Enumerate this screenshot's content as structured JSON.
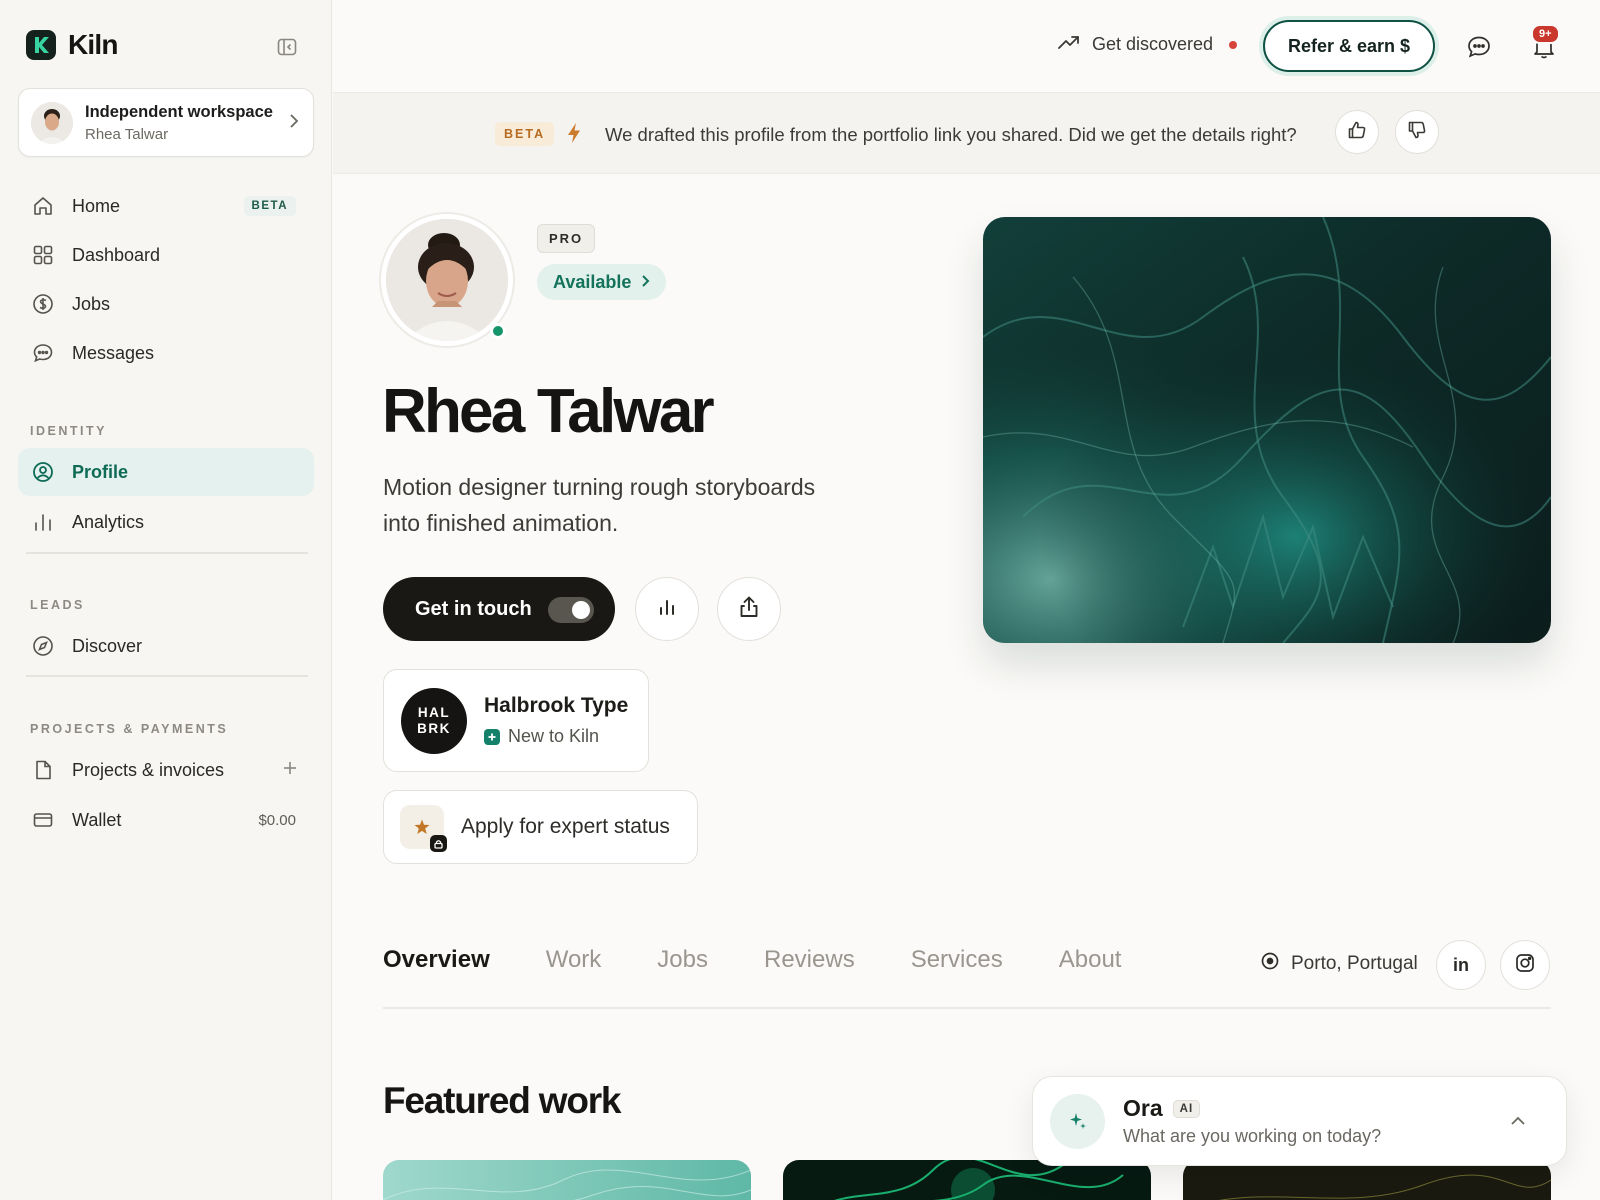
{
  "brand": {
    "name": "Kiln"
  },
  "workspace": {
    "title": "Independent workspace",
    "user": "Rhea Talwar"
  },
  "nav": {
    "main": [
      {
        "label": "Home",
        "badge": "BETA",
        "icon": "home-icon"
      },
      {
        "label": "Dashboard",
        "icon": "dashboard-icon"
      },
      {
        "label": "Jobs",
        "icon": "dollar-icon"
      },
      {
        "label": "Messages",
        "icon": "message-icon"
      }
    ],
    "identity_label": "IDENTITY",
    "identity": [
      {
        "label": "Profile",
        "icon": "profile-icon",
        "active": true
      },
      {
        "label": "Analytics",
        "icon": "analytics-icon"
      }
    ],
    "leads_label": "LEADS",
    "leads": [
      {
        "label": "Discover",
        "icon": "compass-icon"
      }
    ],
    "projects_label": "PROJECTS & PAYMENTS",
    "projects": [
      {
        "label": "Projects & invoices",
        "icon": "file-icon"
      },
      {
        "label": "Wallet",
        "value": "$0.00",
        "icon": "wallet-icon"
      }
    ]
  },
  "topbar": {
    "discover_label": "Get discovered",
    "refer_label": "Refer & earn $",
    "notification_count": "9+"
  },
  "banner": {
    "badge": "BETA",
    "text": "We drafted this profile from the portfolio link you shared. Did we get the details right?"
  },
  "profile": {
    "plan": "PRO",
    "availability": "Available",
    "name": "Rhea Talwar",
    "tagline": "Motion designer turning rough storyboards into finished animation.",
    "cta": "Get in touch",
    "cta_toggle_on": true
  },
  "company": {
    "logo_line1": "HAL",
    "logo_line2": "BRK",
    "name": "Halbrook Type",
    "status": "New to Kiln"
  },
  "expert": {
    "label": "Apply for expert status"
  },
  "tabs": [
    "Overview",
    "Work",
    "Jobs",
    "Reviews",
    "Services",
    "About"
  ],
  "active_tab": "Overview",
  "location": "Porto, Portugal",
  "social": {
    "linkedin": "in"
  },
  "featured_title": "Featured work",
  "ora": {
    "name": "Ora",
    "badge": "AI",
    "prompt": "What are you working on today?"
  },
  "colors": {
    "accent": "#0e6b55",
    "active_bg": "#e4f1ee",
    "beta": "#b56b22",
    "notif": "#c9372d"
  }
}
